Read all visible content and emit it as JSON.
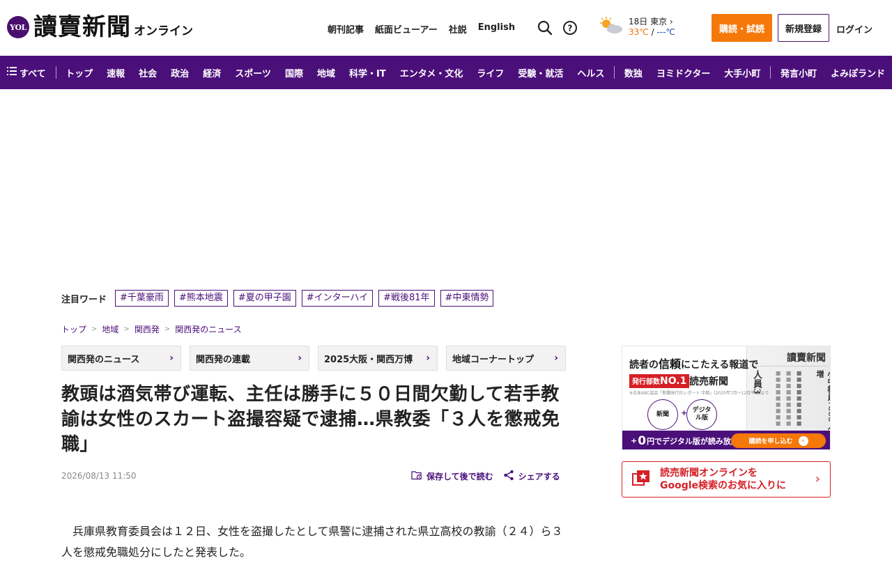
{
  "header": {
    "logo_badge": "YOL",
    "logo_title": "讀賣新聞",
    "logo_suffix": "オンライン",
    "links": [
      "朝刊記事",
      "紙面ビューアー",
      "社説",
      "English"
    ],
    "weather": {
      "date_city": "18日 東京",
      "high": "33℃",
      "sep": " / ",
      "low": "---℃"
    },
    "subscribe_label": "購読・試読",
    "register_label": "新規登録",
    "login_label": "ログイン"
  },
  "nav": {
    "all_label": "すべて",
    "items": [
      "トップ",
      "速報",
      "社会",
      "政治",
      "経済",
      "スポーツ",
      "国際",
      "地域",
      "科学・IT",
      "エンタメ・文化",
      "ライフ",
      "受験・就活",
      "ヘルス"
    ],
    "extra_items": [
      "数独",
      "ヨミドクター",
      "大手小町"
    ],
    "last_items": [
      "発言小町",
      "よみぽランド"
    ]
  },
  "trending": {
    "label": "注目ワード",
    "tags": [
      "#千葉豪雨",
      "#熊本地震",
      "#夏の甲子園",
      "#インターハイ",
      "#戦後81年",
      "#中東情勢"
    ]
  },
  "breadcrumb": [
    "トップ",
    "地域",
    "関西発",
    "関西発のニュース"
  ],
  "subnav": [
    "関西発のニュース",
    "関西発の連載",
    "2025大阪・関西万博",
    "地域コーナートップ"
  ],
  "article": {
    "headline": "教頭は酒気帯び運転、主任は勝手に５０日間欠勤して若手教諭は女性のスカート盗撮容疑で逮捕…県教委「３人を懲戒免職」",
    "date": "2026/08/13 11:50",
    "save_label": "保存して後で読む",
    "share_label": "シェアする",
    "body": "兵庫県教育委員会は１２日、女性を盗撮したとして県警に逮捕された県立高校の教諭（２４）ら３人を懲戒免職処分にしたと発表した。"
  },
  "sidebar": {
    "ad": {
      "tagline_prefix": "読者の",
      "tagline_emph": "信頼",
      "tagline_suffix": "にこたえる報道で",
      "no1_prefix": "発行部数",
      "no1_big": "NO.1",
      "paper_name": "読売新聞",
      "note": "※日本ABC協会「新聞発行社レポート 半期」(2025年7月〜12月平均)より",
      "circle_paper": "新聞",
      "plus": "+",
      "circle_digital": "デジタル版",
      "masthead": "讀賣新聞",
      "col1": "小中教員7000人増",
      "col2": "人員3",
      "bottom_prefix": "+",
      "bottom_zero": "0",
      "bottom_suffix": "円でデジタル版が読み放題!",
      "cta_label": "購読を申し込む"
    },
    "google": {
      "line1": "読売新聞オンラインを",
      "line2": "Google検索のお気に入りに"
    }
  },
  "colors": {
    "brand_purple": "#4b0f7a",
    "subscribe_orange": "#f5780a",
    "accent_red": "#d61f26"
  }
}
